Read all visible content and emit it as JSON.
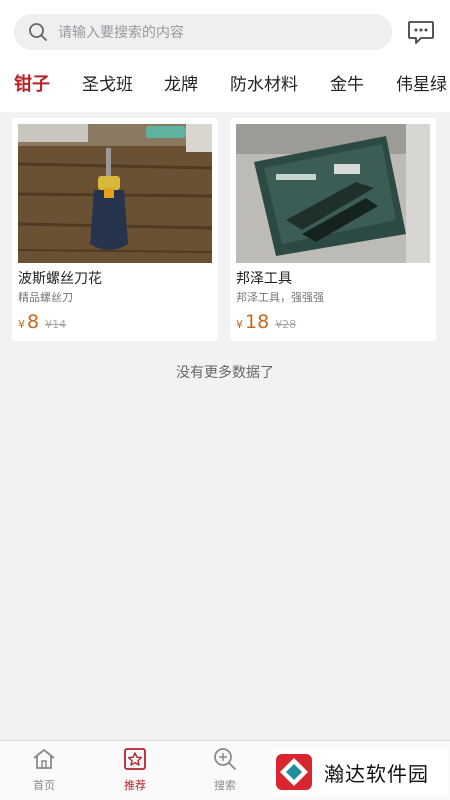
{
  "search": {
    "placeholder": "请输入要搜索的内容",
    "icon": "search-icon"
  },
  "header": {
    "message_icon": "message-icon"
  },
  "categories": [
    {
      "label": "钳子",
      "active": true
    },
    {
      "label": "圣戈班",
      "active": false
    },
    {
      "label": "龙牌",
      "active": false
    },
    {
      "label": "防水材料",
      "active": false
    },
    {
      "label": "金牛",
      "active": false
    },
    {
      "label": "伟星绿",
      "active": false
    }
  ],
  "products": [
    {
      "title": "波斯螺丝刀花",
      "subtitle": "精品螺丝刀",
      "currency": "¥",
      "price": "8",
      "original_price": "¥14",
      "image": "screwdriver-photo"
    },
    {
      "title": "邦泽工具",
      "subtitle": "邦泽工具，强强强",
      "currency": "¥",
      "price": "18",
      "original_price": "¥28",
      "image": "pliers-package-photo"
    }
  ],
  "footer_message": "没有更多数据了",
  "bottom_nav": [
    {
      "label": "首页",
      "icon": "home-icon",
      "active": false
    },
    {
      "label": "推荐",
      "icon": "star-icon",
      "active": true
    },
    {
      "label": "搜索",
      "icon": "search-plus-icon",
      "active": false
    }
  ],
  "watermark": {
    "text": "瀚达软件园"
  },
  "colors": {
    "accent": "#b8222a",
    "price": "#c9681e",
    "background": "#f2f2f4"
  }
}
